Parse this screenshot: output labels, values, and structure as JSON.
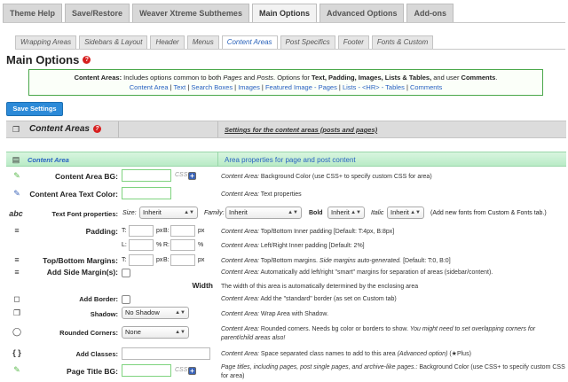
{
  "top_tabs": [
    "Theme Help",
    "Save/Restore",
    "Weaver Xtreme Subthemes",
    "Main Options",
    "Advanced Options",
    "Add-ons"
  ],
  "sub_tabs": [
    "Wrapping Areas",
    "Sidebars & Layout",
    "Header",
    "Menus",
    "Content Areas",
    "Post Specifics",
    "Footer",
    "Fonts & Custom"
  ],
  "page_title": "Main Options",
  "help_glyph": "?",
  "description": {
    "prefix": "Content Areas:",
    "text1": " Includes options common to both ",
    "pages": "Pages",
    "and": " and ",
    "posts": "Posts",
    "text2": ". Options for ",
    "bold_list": "Text, Padding, Images, Lists & Tables,",
    "and_user": " and user ",
    "comments": "Comments",
    "period": ".",
    "links": [
      "Content Area",
      "Text",
      "Search Boxes",
      "Images",
      "Featured Image - Pages",
      "Lists - <HR> - Tables",
      "Comments"
    ],
    "separator": " | "
  },
  "save_button": "Save Settings",
  "section": {
    "title": "Content Areas",
    "description": "Settings for the content areas (posts and pages)"
  },
  "area_header": {
    "title": "Content Area",
    "description": "Area properties for page and post content"
  },
  "rows": {
    "bg": {
      "label": "Content Area BG:",
      "css": "CSS+",
      "help_prefix": "Content Area:",
      "help": " Background Color (use CSS+ to specify custom CSS for area)"
    },
    "text_color": {
      "label": "Content Area Text Color:",
      "help_prefix": "Content Area:",
      "help": " Text properties"
    },
    "font": {
      "label": "Text Font properties:",
      "size_label": "Size:",
      "size_value": "Inherit",
      "family_label": "Family:",
      "family_value": "Inherit",
      "bold_label": "Bold",
      "bold_value": "Inherit",
      "italic_label": "Italic",
      "italic_value": "Inherit",
      "help": "(Add new fonts from Custom & Fonts tab.)"
    },
    "padding": {
      "label": "Padding:",
      "t": "T:",
      "b": "B:",
      "l": "L:",
      "r": "R:",
      "px": "px",
      "pct": "%",
      "help_prefix": "Content Area:",
      "help": " Top/Bottom Inner padding [Default: T:4px, B:8px]",
      "help2_prefix": "Content Area:",
      "help2": " Left/Right Inner padding [Default: 2%]"
    },
    "margins": {
      "label": "Top/Bottom Margins:",
      "t": "T:",
      "b": "B:",
      "px": "px",
      "help_prefix": "Content Area:",
      "help": " Top/Bottom margins.",
      "help_italic": " Side margins auto-generated.",
      "help_tail": " [Default: T:0, B:0]"
    },
    "side_margins": {
      "label": "Add Side Margin(s):",
      "help_prefix": "Content Area:",
      "help": " Automatically add left/right \"smart\" margins for separation of areas (sidebar/content)."
    },
    "width": {
      "label": "Width",
      "help": "The width of this area is automatically determined by the enclosing area"
    },
    "border": {
      "label": "Add Border:",
      "help_prefix": "Content Area:",
      "help": " Add the \"standard\" border (as set on Custom tab)"
    },
    "shadow": {
      "label": "Shadow:",
      "value": "No Shadow",
      "help_prefix": "Content Area:",
      "help": " Wrap Area with Shadow."
    },
    "corners": {
      "label": "Rounded Corners:",
      "value": "None",
      "help_prefix": "Content Area:",
      "help": " Rounded corners. Needs bg color or borders to show.",
      "help_italic": " You might need to set overlapping corners for parent/child areas also!"
    },
    "classes": {
      "label": "Add Classes:",
      "help_prefix": "Content Area:",
      "help": " Space separated class names to add to this area",
      "help_italic": " (Advanced option)",
      "help_tail": " (★Plus)"
    },
    "title_bg": {
      "label": "Page Title BG:",
      "css": "CSS+",
      "help_italic": "Page titles, including pages, post single pages, and archive-like pages.:",
      "help": " Background Color (use CSS+ to specify custom CSS for area)"
    }
  },
  "icons": {
    "section": "copy-icon",
    "area": "layout-icon",
    "bg": "paint-dropper-icon",
    "text_color": "pin-icon",
    "font": "font-icon",
    "padding": "align-icon",
    "margins": "align-icon",
    "side_margins": "align-icon",
    "border": "square-icon",
    "shadow": "copy-icon",
    "corners": "circle-icon",
    "classes": "braces-icon",
    "title_bg": "paint-dropper-icon"
  },
  "icon_glyphs": {
    "section": "❐",
    "area": "▤",
    "dropper": "✎",
    "pin": "✎",
    "font": "abc",
    "align": "≡",
    "square": "◻",
    "circle": "◯",
    "braces": "{ }",
    "plus": "+",
    "arrow": "▲▼"
  },
  "colors": {
    "accent": "#2862c1",
    "save_button": "#2c8ad8",
    "green_border": "#4aa74a",
    "help_red": "#d71f1f"
  }
}
